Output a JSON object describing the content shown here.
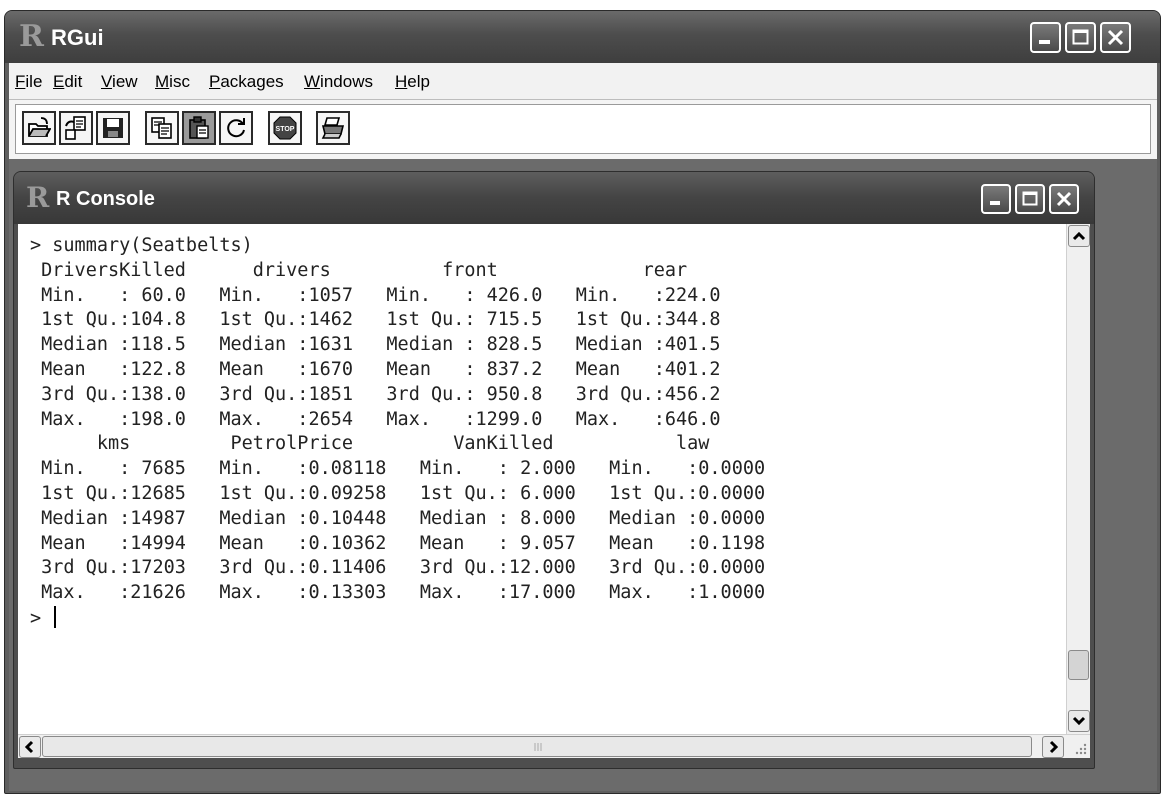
{
  "app": {
    "title": "RGui",
    "menu": [
      "File",
      "Edit",
      "View",
      "Misc",
      "Packages",
      "Windows",
      "Help"
    ],
    "toolbar_buttons": [
      "open-script-icon",
      "load-workspace-icon",
      "save-icon",
      "copy-icon",
      "paste-icon",
      "refresh-icon",
      "stop-icon",
      "print-icon"
    ],
    "stop_label": "STOP"
  },
  "console": {
    "title": "R Console",
    "lines": [
      "> summary(Seatbelts)",
      " DriversKilled      drivers          front             rear      ",
      " Min.   : 60.0   Min.   :1057   Min.   : 426.0   Min.   :224.0  ",
      " 1st Qu.:104.8   1st Qu.:1462   1st Qu.: 715.5   1st Qu.:344.8  ",
      " Median :118.5   Median :1631   Median : 828.5   Median :401.5  ",
      " Mean   :122.8   Mean   :1670   Mean   : 837.2   Mean   :401.2  ",
      " 3rd Qu.:138.0   3rd Qu.:1851   3rd Qu.: 950.8   3rd Qu.:456.2  ",
      " Max.   :198.0   Max.   :2654   Max.   :1299.0   Max.   :646.0  ",
      "      kms         PetrolPrice         VanKilled           law        ",
      " Min.   : 7685   Min.   :0.08118   Min.   : 2.000   Min.   :0.0000  ",
      " 1st Qu.:12685   1st Qu.:0.09258   1st Qu.: 6.000   1st Qu.:0.0000  ",
      " Median :14987   Median :0.10448   Median : 8.000   Median :0.0000  ",
      " Mean   :14994   Mean   :0.10362   Mean   : 9.057   Mean   :0.1198  ",
      " 3rd Qu.:17203   3rd Qu.:0.11406   3rd Qu.:12.000   3rd Qu.:0.0000  ",
      " Max.   :21626   Max.   :0.13303   Max.   :17.000   Max.   :1.0000  "
    ],
    "prompt": "> "
  },
  "colors": {
    "titlebar": "#4d4d4d",
    "menubar": "#f2f2f2",
    "console_bg": "#ffffff",
    "console_text": "#222222"
  }
}
